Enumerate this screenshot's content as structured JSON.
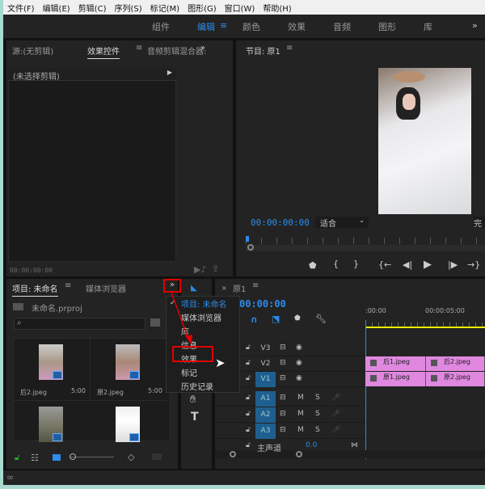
{
  "menubar": [
    "文件(F)",
    "编辑(E)",
    "剪辑(C)",
    "序列(S)",
    "标记(M)",
    "图形(G)",
    "窗口(W)",
    "帮助(H)"
  ],
  "workspaces": {
    "items": [
      "组件",
      "编辑",
      "颜色",
      "效果",
      "音频",
      "图形",
      "库"
    ],
    "active": "编辑",
    "more": "»"
  },
  "source_panel": {
    "tabs": [
      "源:(无剪辑)",
      "效果控件",
      "音频剪辑混合器:"
    ],
    "active": "效果控件",
    "more": "»",
    "no_clip": "(未选择剪辑)",
    "timecode": "00:00:00:00"
  },
  "program": {
    "title": "节目: 原1",
    "timecode": "00:00:00:00",
    "fit": "适合",
    "quality": "完"
  },
  "project": {
    "tabs": [
      "项目: 未命名",
      "媒体浏览器"
    ],
    "more": "»",
    "file": "未命名.prproj",
    "search_placeholder": "",
    "items": [
      {
        "name": "后2.jpeg",
        "duration": "5:00"
      },
      {
        "name": "原2.jpeg",
        "duration": "5:00"
      },
      {
        "name": "",
        "duration": ""
      },
      {
        "name": "",
        "duration": ""
      }
    ]
  },
  "menu": {
    "items": [
      "项目: 未命名",
      "媒体浏览器",
      "库",
      "信息",
      "效果",
      "标记",
      "历史记录"
    ],
    "checked": "项目: 未命名",
    "highlighted": "效果"
  },
  "timeline": {
    "tab": "原1",
    "timecode": "00:00:00",
    "ruler": [
      ":00:00",
      "00:00:05:00"
    ],
    "video_tracks": [
      "V3",
      "V2",
      "V1"
    ],
    "audio_tracks": [
      "A1",
      "A2",
      "A3"
    ],
    "m": "M",
    "s": "S",
    "master": "主声道",
    "master_value": "0.0",
    "clips_v2": [
      "后1.jpeg",
      "后2.jpeg"
    ],
    "clips_v1": [
      "原1.jpeg",
      "原2.jpeg"
    ]
  },
  "colors": {
    "accent": "#2d8ceb",
    "clip": "#e088e0",
    "highlight": "#e00000"
  }
}
